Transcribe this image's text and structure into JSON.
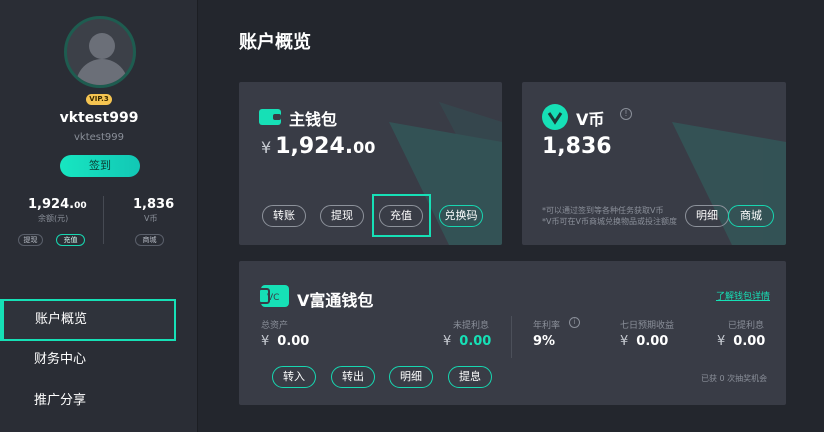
{
  "user": {
    "vip": "VIP.3",
    "name": "vktest999",
    "id": "vktest999",
    "signin": "签到"
  },
  "stats": {
    "balance_int": "1,924.",
    "balance_dec": "00",
    "balance_label": "余额(元)",
    "vcoin": "1,836",
    "vcoin_label": "V币",
    "withdraw": "提现",
    "recharge": "充值",
    "mall": "商城"
  },
  "nav": [
    {
      "label": "账户概览"
    },
    {
      "label": "财务中心"
    },
    {
      "label": "推广分享"
    }
  ],
  "page": {
    "title": "账户概览"
  },
  "main_wallet": {
    "title": "主钱包",
    "currency": "¥",
    "amount_int": "1,924.",
    "amount_dec": "00",
    "buttons": [
      "转账",
      "提现",
      "充值",
      "兑换码"
    ]
  },
  "vcoin_card": {
    "title": "V币",
    "amount": "1,836",
    "note1": "*可以通过签到等各种任务获取V币",
    "note2": "*V币可在V币商城兑换物品或投注额度",
    "buttons": [
      "明细",
      "商城"
    ]
  },
  "vfu": {
    "title": "V富通钱包",
    "link": "了解钱包详情",
    "total_label": "总资产",
    "total_currency": "¥",
    "total": "0.00",
    "unclaimed_label": "未提利息",
    "unclaimed_currency": "¥",
    "unclaimed": "0.00",
    "rate_label": "年利率",
    "rate": "9%",
    "seven_label": "七日预期收益",
    "seven_currency": "¥",
    "seven": "0.00",
    "withdrawn_label": "已提利息",
    "withdrawn_currency": "¥",
    "withdrawn": "0.00",
    "buttons": [
      "转入",
      "转出",
      "明细",
      "提息"
    ],
    "lottery": "已获 0 次抽奖机会"
  },
  "colors": {
    "accent": "#16e0b6",
    "bg": "#23262d",
    "card": "#393c46",
    "vip": "#f5c451"
  }
}
